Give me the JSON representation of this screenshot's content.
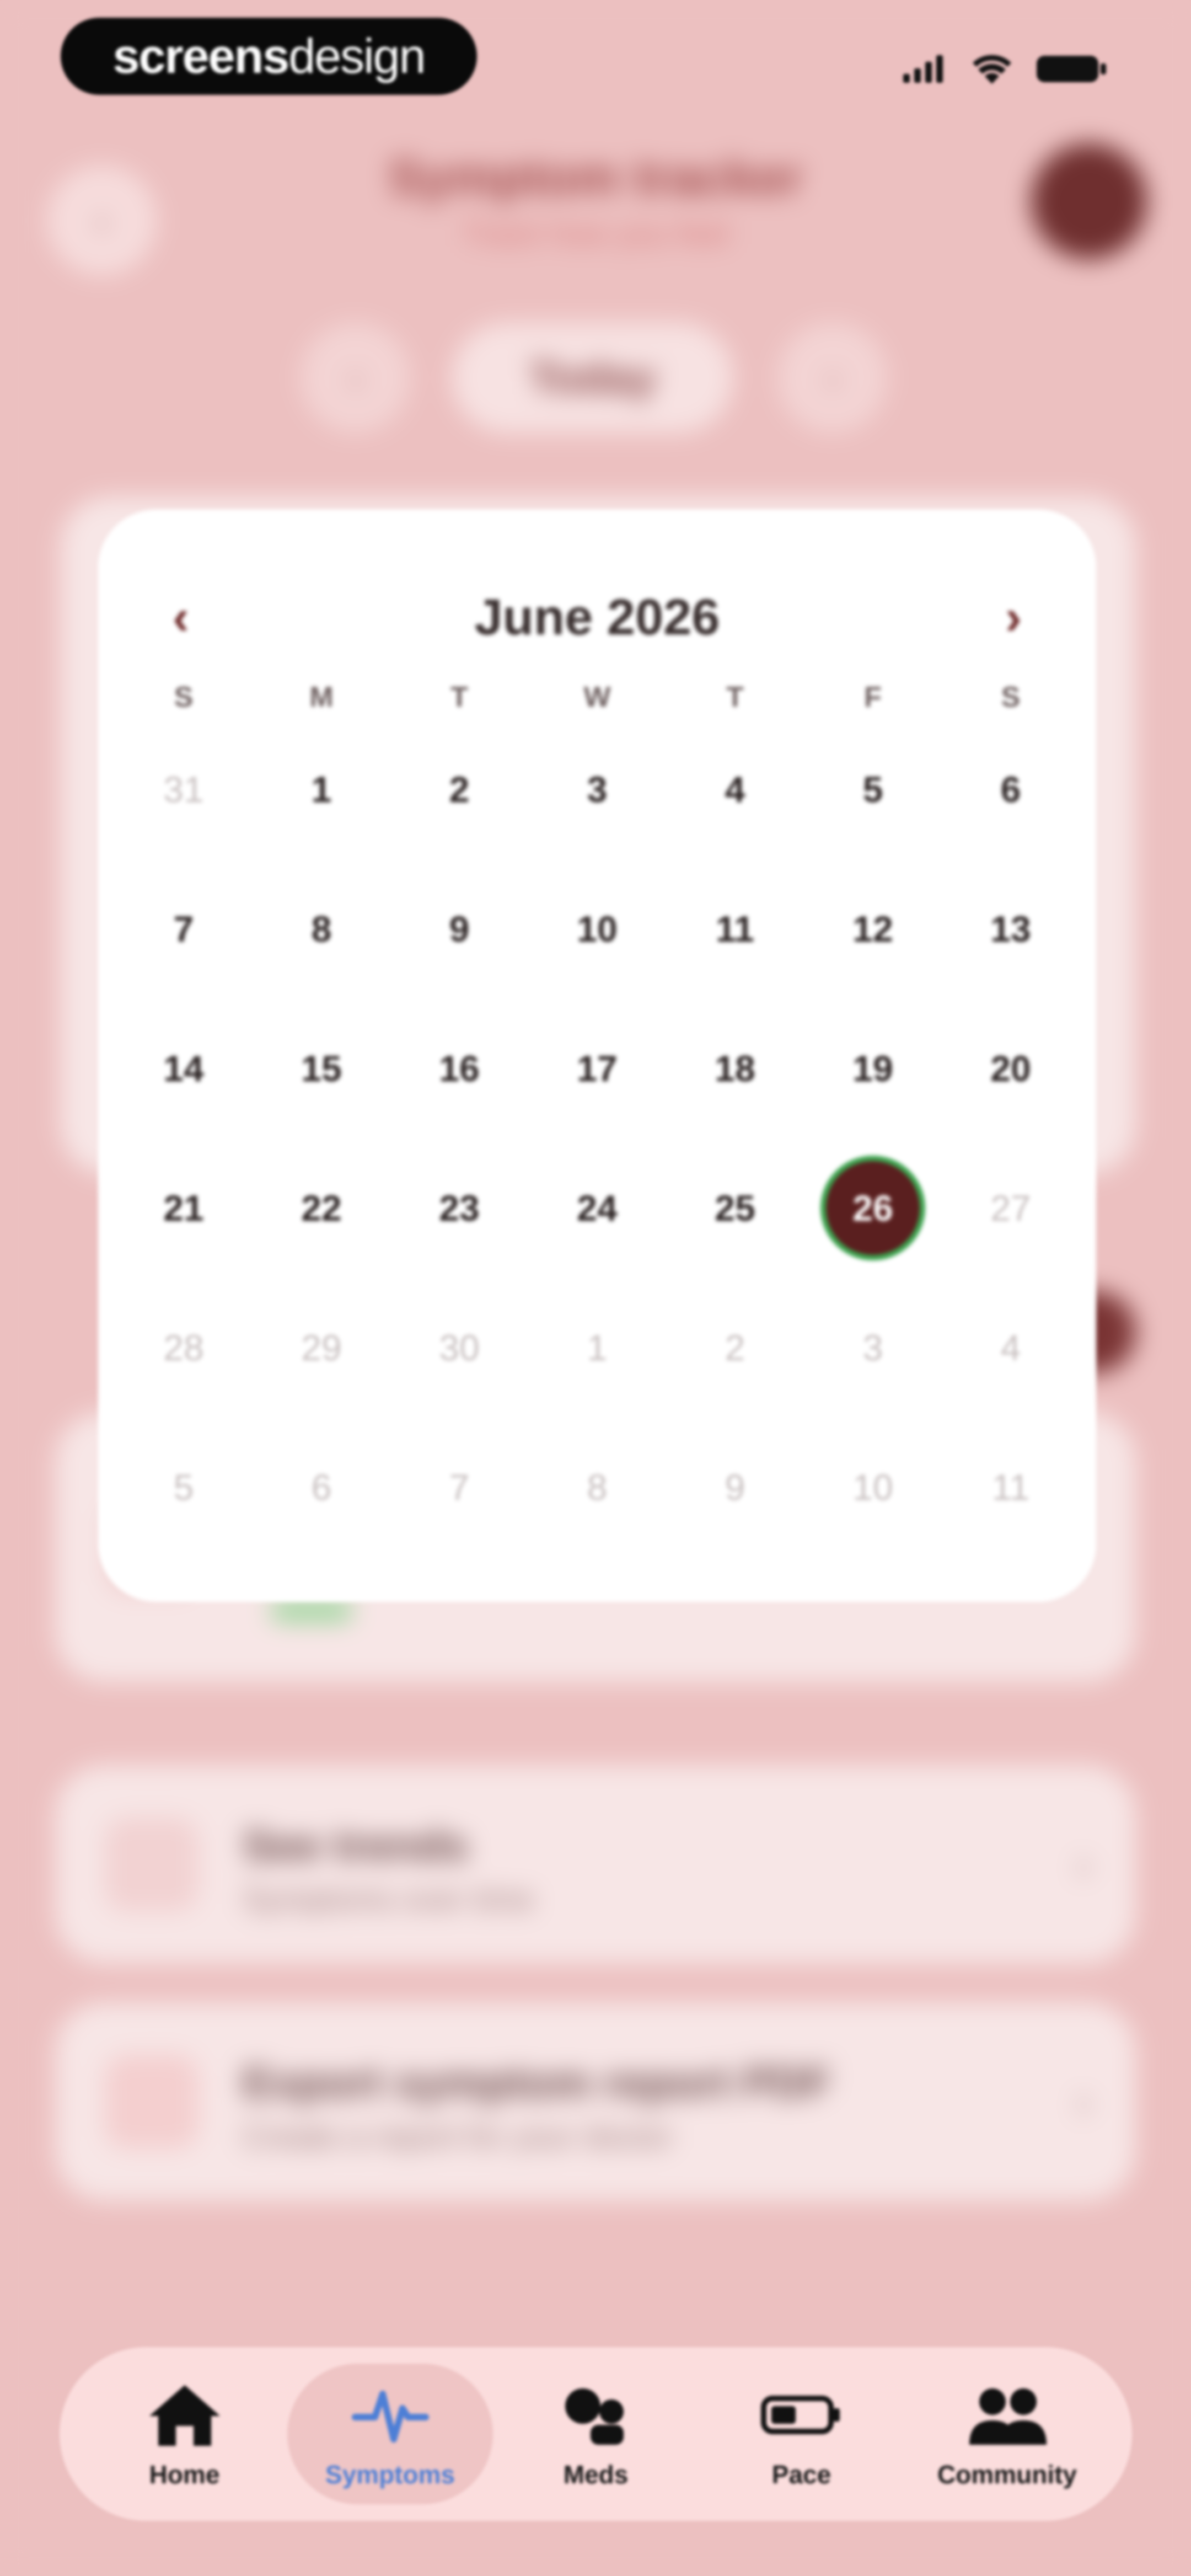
{
  "status_bar": {
    "brand_bold": "screens",
    "brand_light": "design"
  },
  "background": {
    "header_title": "Symptom tracker",
    "header_subtitle": "Track how you feel",
    "date_pill": "Today",
    "cards": [
      {
        "title": "See trends",
        "subtitle": "Symptoms over time"
      },
      {
        "title": "Export symptom report PDF",
        "subtitle": "Create a report for your doctor"
      }
    ]
  },
  "calendar": {
    "month_label": "June 2026",
    "weekdays": [
      "S",
      "M",
      "T",
      "W",
      "T",
      "F",
      "S"
    ],
    "days": [
      {
        "n": "31",
        "muted": true
      },
      {
        "n": "1"
      },
      {
        "n": "2"
      },
      {
        "n": "3"
      },
      {
        "n": "4"
      },
      {
        "n": "5"
      },
      {
        "n": "6"
      },
      {
        "n": "7"
      },
      {
        "n": "8"
      },
      {
        "n": "9"
      },
      {
        "n": "10"
      },
      {
        "n": "11"
      },
      {
        "n": "12"
      },
      {
        "n": "13"
      },
      {
        "n": "14"
      },
      {
        "n": "15"
      },
      {
        "n": "16"
      },
      {
        "n": "17"
      },
      {
        "n": "18"
      },
      {
        "n": "19"
      },
      {
        "n": "20"
      },
      {
        "n": "21"
      },
      {
        "n": "22"
      },
      {
        "n": "23"
      },
      {
        "n": "24"
      },
      {
        "n": "25"
      },
      {
        "n": "26",
        "selected": true
      },
      {
        "n": "27",
        "muted": true
      },
      {
        "n": "28",
        "muted": true
      },
      {
        "n": "29",
        "muted": true
      },
      {
        "n": "30",
        "muted": true
      },
      {
        "n": "1",
        "muted": true
      },
      {
        "n": "2",
        "muted": true
      },
      {
        "n": "3",
        "muted": true
      },
      {
        "n": "4",
        "muted": true
      },
      {
        "n": "5",
        "muted": true
      },
      {
        "n": "6",
        "muted": true
      },
      {
        "n": "7",
        "muted": true
      },
      {
        "n": "8",
        "muted": true
      },
      {
        "n": "9",
        "muted": true
      },
      {
        "n": "10",
        "muted": true
      },
      {
        "n": "11",
        "muted": true
      }
    ],
    "selected_color": "#5a1f1f",
    "selected_ring_color": "#3da34f"
  },
  "tabbar": {
    "tabs": [
      {
        "label": "Home",
        "icon": "home-icon"
      },
      {
        "label": "Symptoms",
        "icon": "pulse-icon",
        "active": true
      },
      {
        "label": "Meds",
        "icon": "pills-icon"
      },
      {
        "label": "Pace",
        "icon": "battery-icon"
      },
      {
        "label": "Community",
        "icon": "people-icon"
      }
    ],
    "active_color": "#4d7fd6"
  }
}
